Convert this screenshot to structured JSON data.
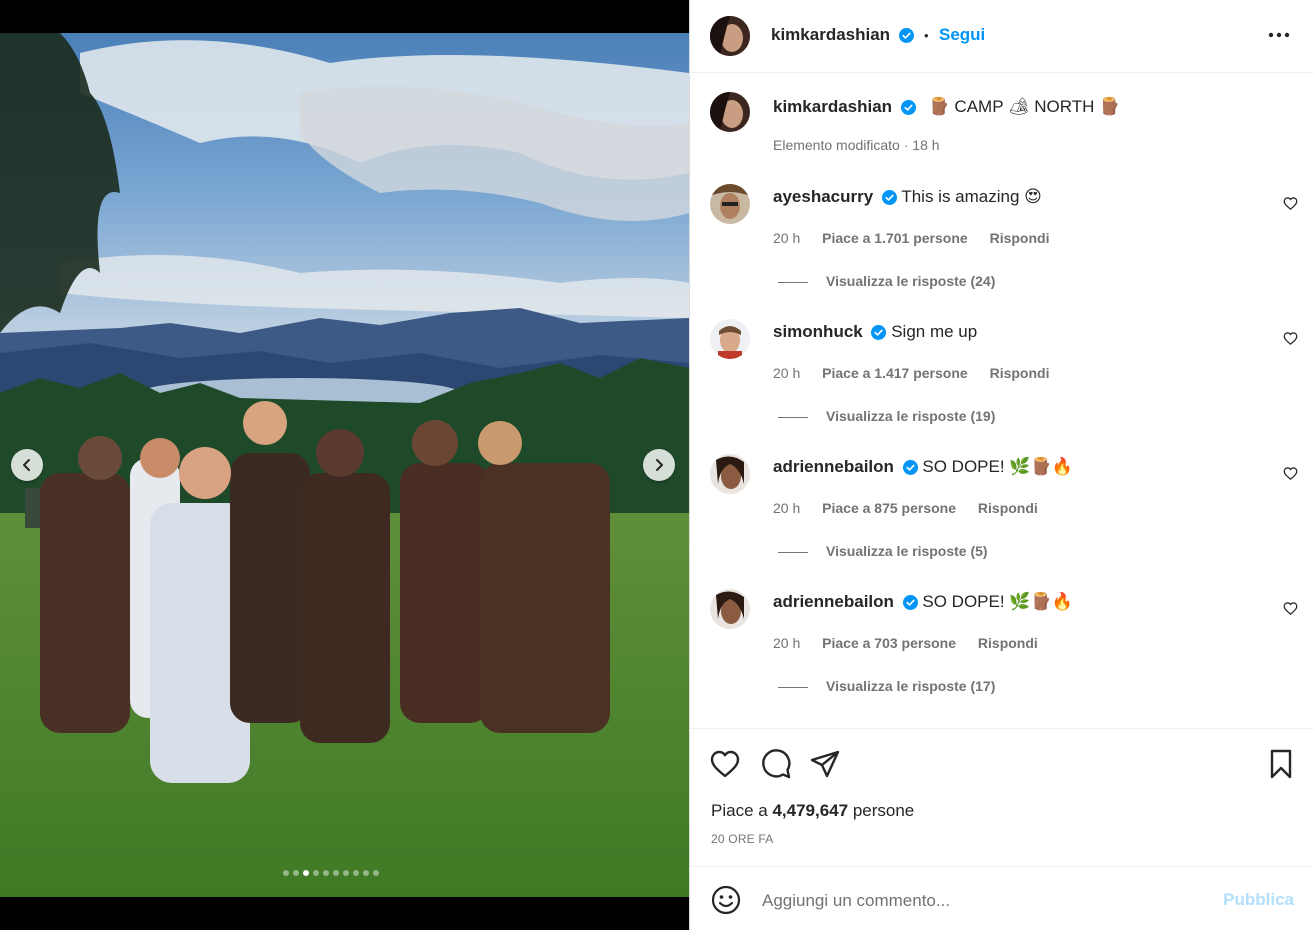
{
  "media": {
    "carousel_dots": 10,
    "active_dot": 3,
    "prev_icon": "chevron-left-icon",
    "next_icon": "chevron-right-icon"
  },
  "header": {
    "username": "kimkardashian",
    "separator": "•",
    "follow_label": "Segui",
    "more_icon": "more-horizontal-icon"
  },
  "caption": {
    "username": "kimkardashian",
    "text": "🪵 CAMP 🏕 NORTH 🪵",
    "meta": "Elemento modificato · 18 h"
  },
  "comments": [
    {
      "username": "ayeshacurry",
      "text": "This is amazing 😍",
      "time": "20 h",
      "likes": "Piace a 1.701 persone",
      "reply": "Rispondi",
      "view_replies": "Visualizza le risposte (24)"
    },
    {
      "username": "simonhuck",
      "text": "Sign me up",
      "time": "20 h",
      "likes": "Piace a 1.417 persone",
      "reply": "Rispondi",
      "view_replies": "Visualizza le risposte (19)"
    },
    {
      "username": "adriennebailon",
      "text": "SO DOPE! 🌿🪵🔥",
      "time": "20 h",
      "likes": "Piace a 875 persone",
      "reply": "Rispondi",
      "view_replies": "Visualizza le risposte (5)"
    },
    {
      "username": "adriennebailon",
      "text": "SO DOPE! 🌿🪵🔥",
      "time": "20 h",
      "likes": "Piace a 703 persone",
      "reply": "Rispondi",
      "view_replies": "Visualizza le risposte (17)"
    }
  ],
  "actions": {
    "likes_prefix": "Piace a",
    "likes_count": "4,479,647",
    "likes_suffix": "persone",
    "time": "20 ORE FA"
  },
  "add_comment": {
    "placeholder": "Aggiungi un commento...",
    "publish_label": "Pubblica"
  },
  "colors": {
    "accent": "#0095f6",
    "publish_disabled": "#b2dffc",
    "secondary_text": "#737373"
  }
}
